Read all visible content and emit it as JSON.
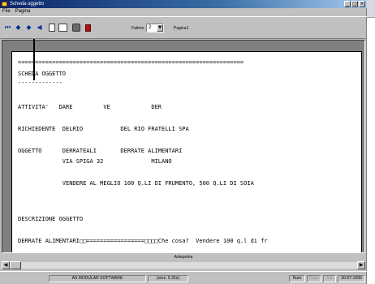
{
  "window": {
    "title": "Scheda oggetto",
    "controls": [
      "_",
      "□",
      "×"
    ]
  },
  "menu": [
    "File",
    "Pagina"
  ],
  "toolbar": {
    "nav_buttons": [
      {
        "name": "first-page-button",
        "glyph": "⏮"
      },
      {
        "name": "prev-page-button",
        "glyph": "◆"
      },
      {
        "name": "next-page-button",
        "glyph": "◆"
      },
      {
        "name": "last-page-button",
        "glyph": "◀"
      }
    ],
    "zoom_label": "Fattore",
    "zoom_value": "2",
    "page_label": "Pagina1"
  },
  "report_lines": [
    "==================================================================",
    "SCHEDA OGGETTO",
    "-------------",
    "ATTIVITA'   DARE         VE            DER",
    "RICHIEDENTE  DELRIO           DEL RIO FRATELLI SPA",
    "OGGETTO      DERRATEALI       DERRATE ALIMENTARI",
    "             VIA SPIGA 32              MILANO",
    "             VENDERE AL MEGLIO 100 Q.LI DI FRUMENTO, 500 Q.LI DI SOIA",
    "DESCRIZIONE OGGETTO",
    "DERRATE ALIMENTARI□□=================□□□□Che cosa?  Vendere 100 q.l di fr"
  ],
  "panel_label": "Anteprima",
  "status": {
    "app": "AS MODULAR SOFTWARE",
    "version": "(vers. 5.32e)",
    "num": "Num",
    "caps": "Caps",
    "ins": "Ins",
    "date": "30-07-1999"
  }
}
